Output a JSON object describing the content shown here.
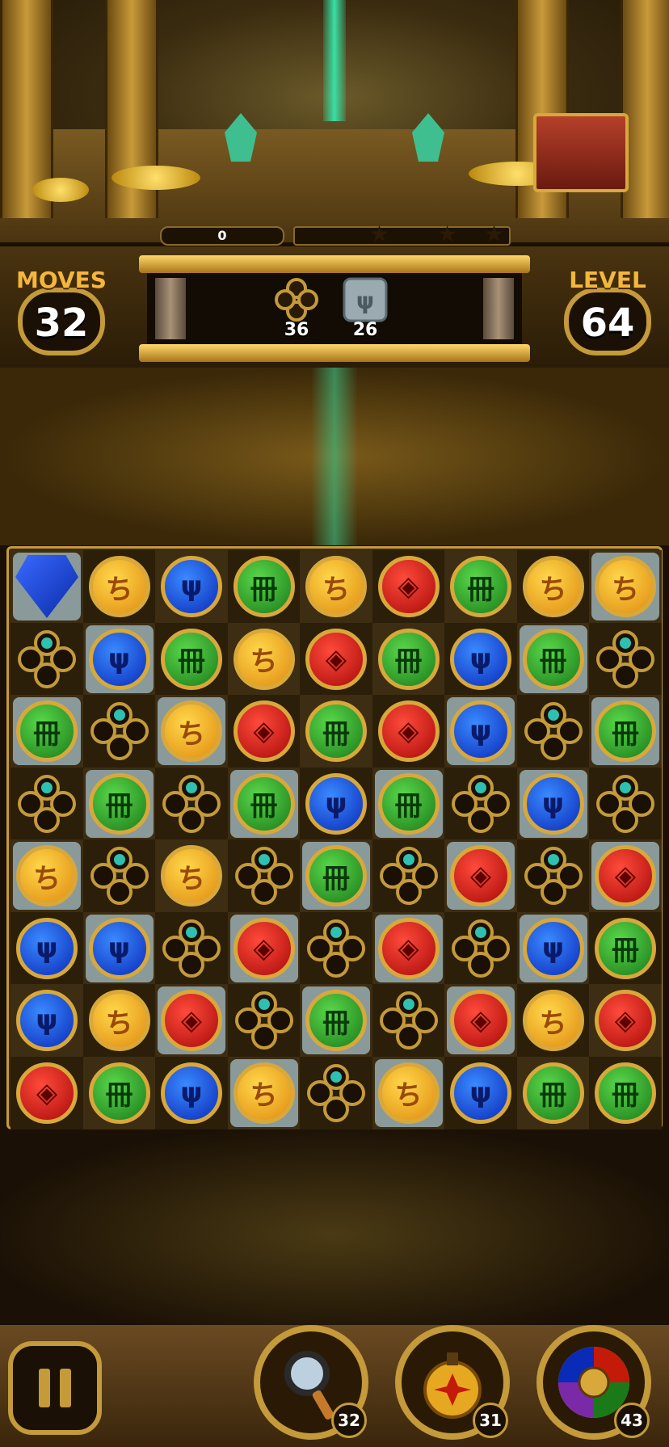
{
  "hud": {
    "score": "0",
    "moves_label": "MOVES",
    "moves_value": "32",
    "level_label": "LEVEL",
    "level_value": "64"
  },
  "goals": [
    {
      "icon": "ring-cage-icon",
      "count": "36"
    },
    {
      "icon": "stone-tile-icon",
      "count": "26"
    }
  ],
  "boosters": [
    {
      "icon": "magnifier-icon",
      "count": "32"
    },
    {
      "icon": "bomb-icon",
      "count": "31"
    },
    {
      "icon": "color-wheel-icon",
      "count": "43"
    }
  ],
  "board": {
    "cols": 9,
    "rows": 8,
    "grid": [
      [
        "stone-diamond",
        "yellow",
        "blue",
        "green",
        "yellow",
        "red",
        "green",
        "yellow",
        "yellow"
      ],
      [
        "ring",
        "blue",
        "green",
        "yellow",
        "red",
        "green",
        "blue",
        "green",
        "ring"
      ],
      [
        "green",
        "ring",
        "yellow",
        "red",
        "green",
        "red",
        "blue",
        "ring",
        "green"
      ],
      [
        "ring",
        "green",
        "ring",
        "green",
        "blue",
        "green",
        "ring",
        "blue",
        "ring"
      ],
      [
        "yellow",
        "ring",
        "yellow",
        "ring",
        "green",
        "ring",
        "red",
        "ring",
        "red"
      ],
      [
        "blue",
        "blue",
        "ring",
        "red",
        "ring",
        "red",
        "ring",
        "blue",
        "green"
      ],
      [
        "blue",
        "yellow",
        "red",
        "ring",
        "green",
        "ring",
        "red",
        "yellow",
        "red"
      ],
      [
        "red",
        "green",
        "blue",
        "yellow",
        "ring",
        "yellow",
        "blue",
        "green",
        "green"
      ]
    ],
    "stone_under": [
      [
        1,
        0,
        0,
        0,
        0,
        0,
        0,
        0,
        1
      ],
      [
        0,
        1,
        0,
        0,
        0,
        0,
        0,
        1,
        0
      ],
      [
        1,
        0,
        1,
        0,
        0,
        0,
        1,
        0,
        1
      ],
      [
        0,
        1,
        0,
        1,
        0,
        1,
        0,
        1,
        0
      ],
      [
        1,
        0,
        0,
        0,
        1,
        0,
        1,
        0,
        1
      ],
      [
        0,
        1,
        0,
        1,
        0,
        1,
        0,
        1,
        0
      ],
      [
        0,
        0,
        1,
        0,
        1,
        0,
        1,
        0,
        0
      ],
      [
        0,
        0,
        0,
        1,
        0,
        1,
        0,
        0,
        0
      ]
    ]
  },
  "colors": {
    "gold": "#c49a3a",
    "yellow_gem": "#e08a10",
    "blue_gem": "#0a2ab8",
    "green_gem": "#1a7a1a",
    "red_gem": "#a80a0a"
  }
}
